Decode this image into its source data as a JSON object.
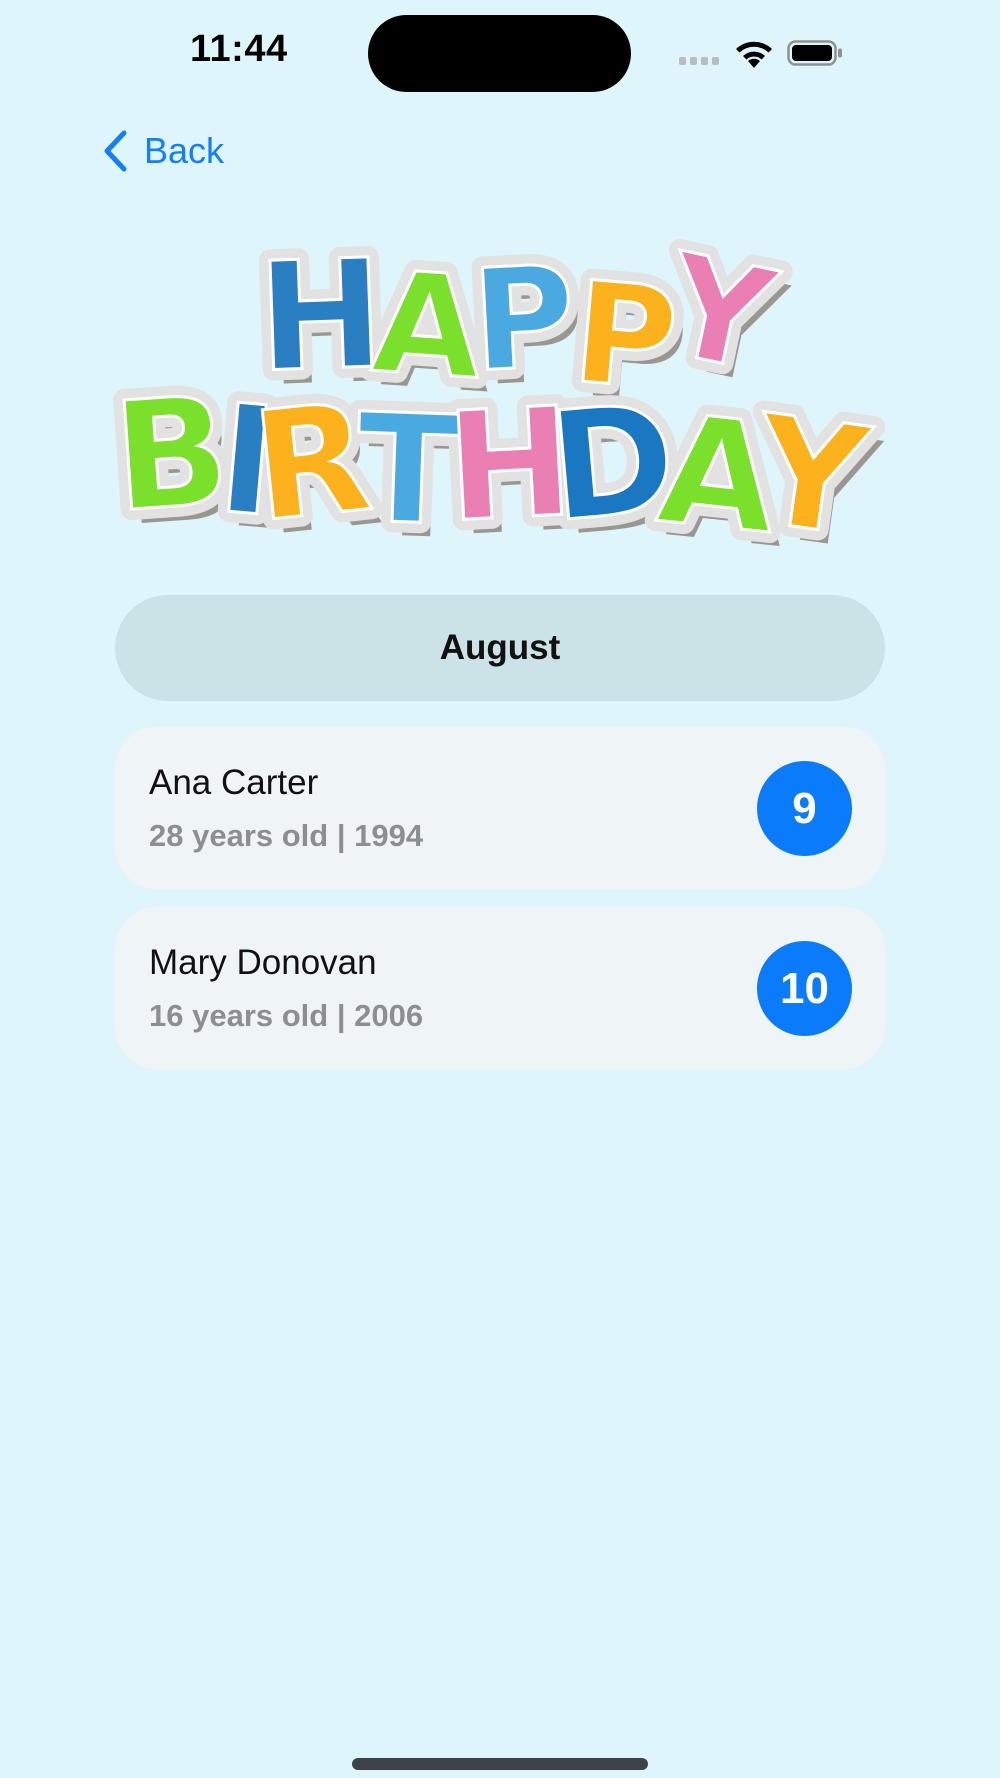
{
  "status_bar": {
    "time": "11:44"
  },
  "nav": {
    "back_label": "Back",
    "accent_color": "#147efb"
  },
  "header_art": {
    "text": "HAPPY BIRTHDAY"
  },
  "month": {
    "label": "August"
  },
  "birthdays": [
    {
      "name": "Ana Carter",
      "meta": "28 years old | 1994",
      "day": "9"
    },
    {
      "name": "Mary Donovan",
      "meta": "16 years old | 2006",
      "day": "10"
    }
  ],
  "icons": {
    "back": "chevron-left-icon",
    "wifi": "wifi-icon",
    "battery": "battery-icon",
    "signal": "cellular-signal-icon"
  }
}
